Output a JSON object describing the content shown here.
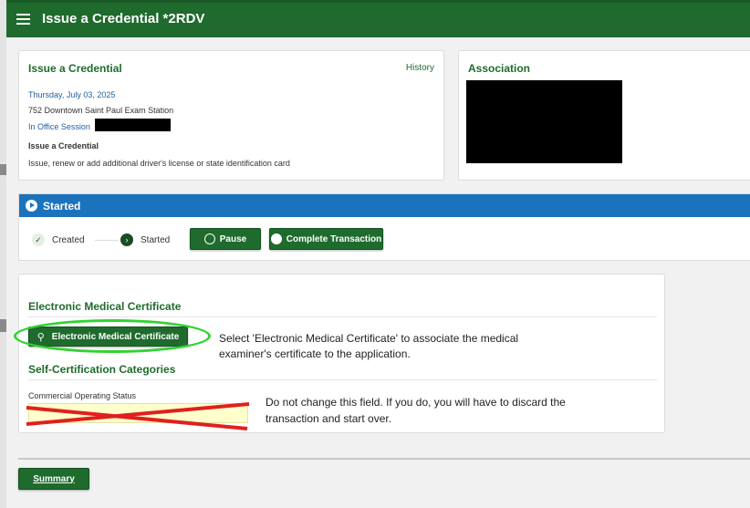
{
  "header": {
    "title": "Issue a Credential *2RDV"
  },
  "issue_card": {
    "title": "Issue a Credential",
    "history_link": "History",
    "date": "Thursday, July 03, 2025",
    "location": "752 Downtown Saint Paul Exam Station",
    "session": "In Office Session",
    "subtitle": "Issue a Credential",
    "description": "Issue, renew or add additional driver's license or state identification card"
  },
  "association_card": {
    "title": "Association"
  },
  "status": {
    "title": "Started",
    "steps": [
      {
        "label": "Created",
        "state": "done"
      },
      {
        "label": "Started",
        "state": "current"
      }
    ],
    "pause_button": "Pause",
    "complete_button": "Complete Transaction"
  },
  "emc_section": {
    "title": "Electronic Medical Certificate",
    "button_label": "Electronic Medical Certificate",
    "instruction": "Select 'Electronic Medical Certificate' to associate the medical examiner's certificate to the application.",
    "self_cert_title": "Self-Certification Categories",
    "field_label": "Commercial Operating Status",
    "field_value": "",
    "warning": "Do not change this field. If you do, you will have to discard the transaction and start over."
  },
  "footer": {
    "summary_button": "Summary"
  },
  "colors": {
    "header_green": "#1f6b2d",
    "status_blue": "#1c73bd",
    "highlight_oval": "#31d331",
    "cross_red": "#e0201e"
  }
}
